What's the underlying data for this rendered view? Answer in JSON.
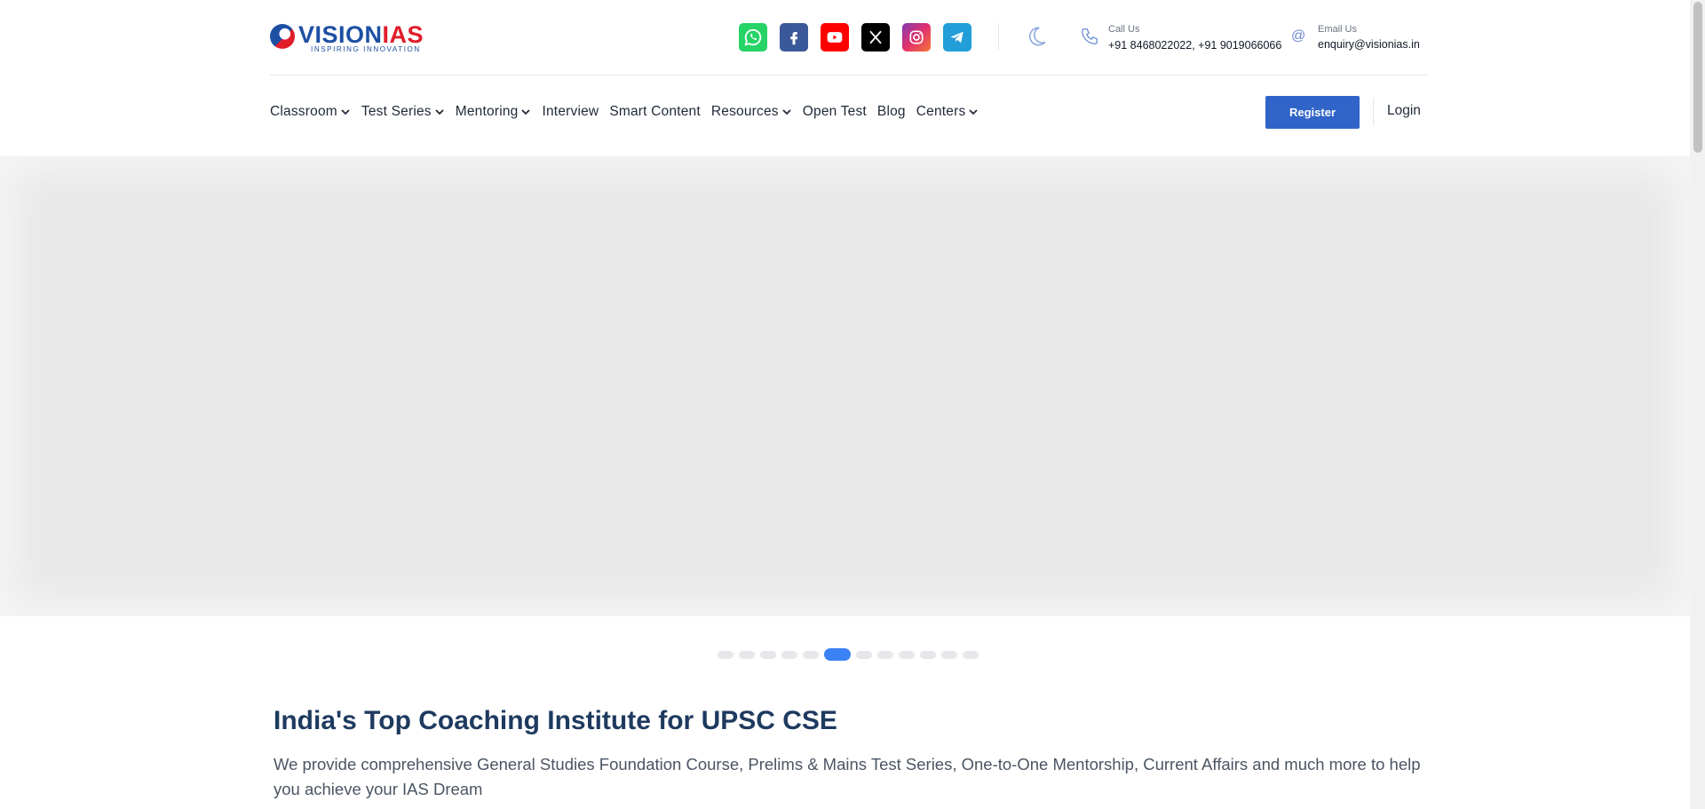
{
  "brand": {
    "logo_text_primary": "VISION",
    "logo_text_accent": "IAS",
    "tagline": "INSPIRING INNOVATION"
  },
  "social": [
    {
      "name": "whatsapp-icon",
      "color": "#25d366"
    },
    {
      "name": "facebook-icon",
      "color": "#3b5998"
    },
    {
      "name": "youtube-icon",
      "color": "#ff0000"
    },
    {
      "name": "x-icon",
      "color": "#000000"
    },
    {
      "name": "instagram-icon",
      "color": "#c13584"
    },
    {
      "name": "telegram-icon",
      "color": "#229ed9"
    }
  ],
  "theme_toggle_icon": "moon-icon",
  "contact": {
    "call_label": "Call Us",
    "call_value": "+91 8468022022, +91 9019066066",
    "email_label": "Email Us",
    "email_value": "enquiry@visionias.in"
  },
  "nav": {
    "items": [
      {
        "label": "Classroom",
        "dropdown": true
      },
      {
        "label": "Test Series",
        "dropdown": true
      },
      {
        "label": "Mentoring",
        "dropdown": true
      },
      {
        "label": "Interview",
        "dropdown": false
      },
      {
        "label": "Smart Content",
        "dropdown": false
      },
      {
        "label": "Resources",
        "dropdown": true
      },
      {
        "label": "Open Test",
        "dropdown": false
      },
      {
        "label": "Blog",
        "dropdown": false
      },
      {
        "label": "Centers",
        "dropdown": true
      }
    ],
    "register_label": "Register",
    "login_label": "Login"
  },
  "carousel": {
    "total_slides": 12,
    "active_index": 5
  },
  "intro": {
    "headline": "India's Top Coaching Institute for UPSC CSE",
    "description": "We provide comprehensive General Studies Foundation Course, Prelims & Mains Test Series, One-to-One Mentorship, Current Affairs and much more to help you achieve your IAS Dream"
  },
  "colors": {
    "brand_blue": "#1d4fa3",
    "brand_red": "#e11d2a",
    "primary_button": "#3064c8",
    "active_dot": "#3b82f6",
    "headline": "#1e3a5f"
  }
}
